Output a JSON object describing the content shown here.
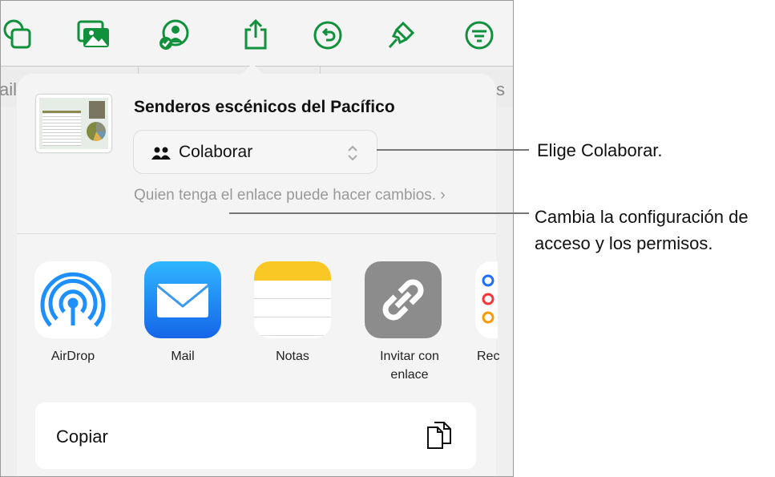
{
  "toolbar": {
    "icons": [
      "shapes-icon",
      "media-icon",
      "collaborate-icon",
      "share-icon",
      "undo-icon",
      "format-brush-icon",
      "organize-icon"
    ],
    "accent": "#11913c"
  },
  "subbar": {
    "left_text": "ail",
    "right_text": "s"
  },
  "share_sheet": {
    "document_title": "Senderos escénicos del Pacífico",
    "mode": "Colaborar",
    "access_description": "Quien tenga el enlace puede hacer cambios.",
    "apps": [
      {
        "label": "AirDrop"
      },
      {
        "label": "Mail"
      },
      {
        "label": "Notas"
      },
      {
        "label": "Invitar con enlace"
      },
      {
        "label": "Rec"
      }
    ],
    "copy_label": "Copiar"
  },
  "callouts": {
    "choose": "Elige Colaborar.",
    "change": "Cambia la configuración de acceso y los permisos."
  }
}
